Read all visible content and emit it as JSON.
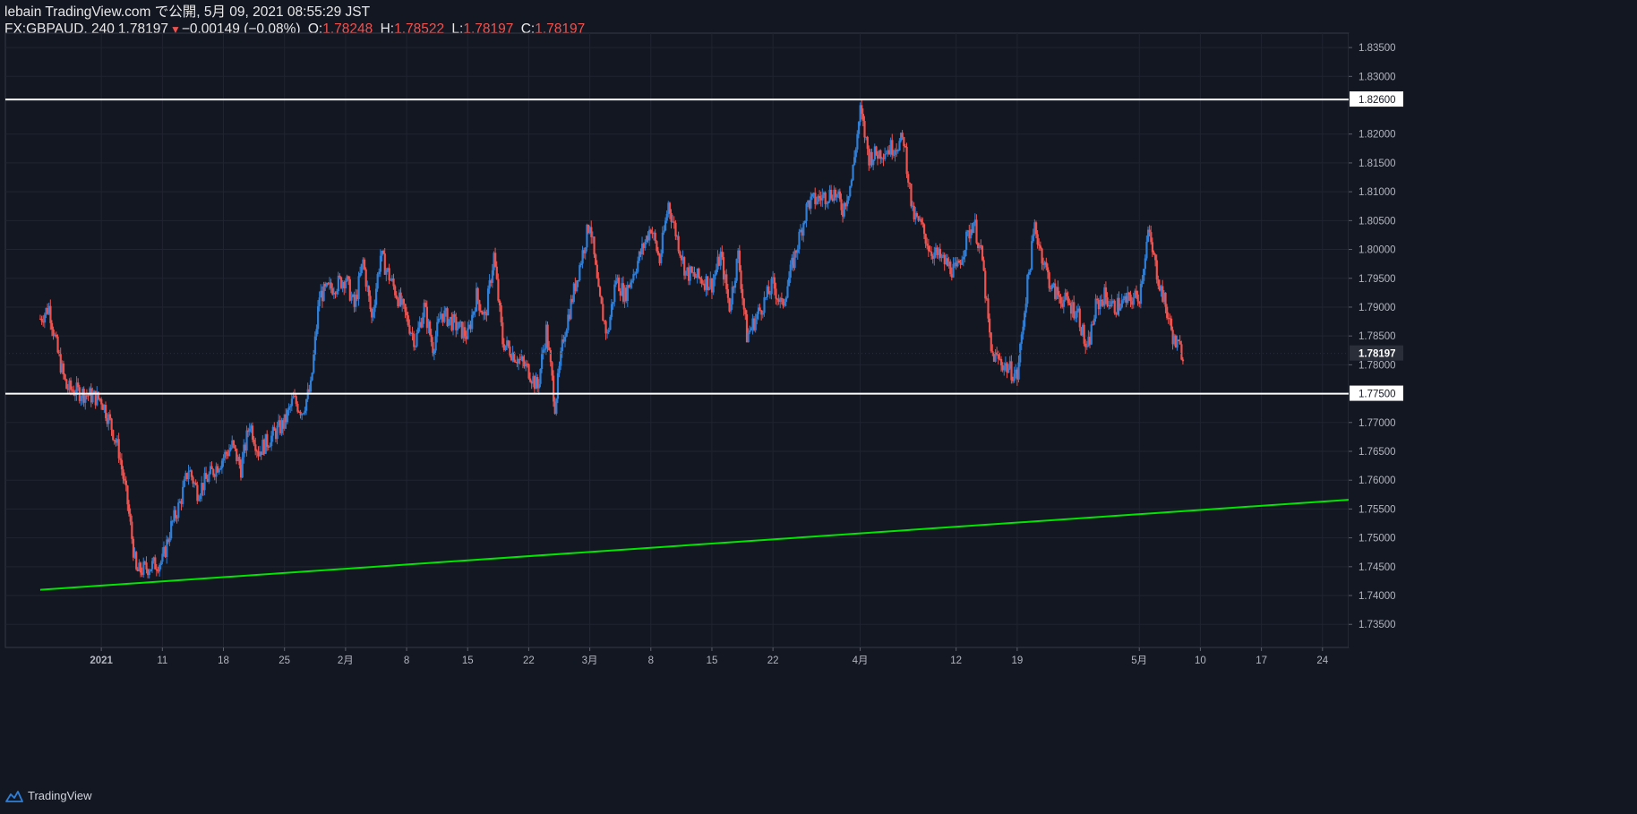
{
  "header": {
    "published": "lebain TradingView.com で公開, 5月 09, 2021 08:55:29 JST",
    "symbol": "FX:GBPAUD, 240",
    "last": "1.78197",
    "change": "−0.00149 (−0.08%)",
    "o_label": "O:",
    "o_value": "1.78248",
    "h_label": "H:",
    "h_value": "1.78522",
    "l_label": "L:",
    "l_value": "1.78197",
    "c_label": "C:",
    "c_value": "1.78197"
  },
  "footer": {
    "brand": "TradingView"
  },
  "colors": {
    "up": "#2f7fd8",
    "down": "#ef5350",
    "background": "#131722",
    "grid": "#1f2430",
    "trendline": "#00e600",
    "level": "#ffffff",
    "axis_text": "#b2b5be"
  },
  "chart_data": {
    "type": "candlestick",
    "symbol": "FX:GBPAUD",
    "interval": "240",
    "ylim": [
      1.731,
      1.8375
    ],
    "y_ticks": [
      "1.83500",
      "1.83000",
      "1.82600",
      "1.82000",
      "1.81500",
      "1.81000",
      "1.80500",
      "1.80000",
      "1.79500",
      "1.79000",
      "1.78500",
      "1.78197",
      "1.78000",
      "1.77500",
      "1.77000",
      "1.76500",
      "1.76000",
      "1.75500",
      "1.75000",
      "1.74500",
      "1.74000",
      "1.73500"
    ],
    "y_tick_values": [
      1.835,
      1.83,
      1.826,
      1.82,
      1.815,
      1.81,
      1.805,
      1.8,
      1.795,
      1.79,
      1.785,
      1.78197,
      1.78,
      1.775,
      1.77,
      1.765,
      1.76,
      1.755,
      1.75,
      1.745,
      1.74,
      1.735
    ],
    "x_ticks": [
      "2021",
      "11",
      "18",
      "25",
      "2月",
      "8",
      "15",
      "22",
      "3月",
      "8",
      "15",
      "22",
      "4月",
      "12",
      "19",
      "5月",
      "10",
      "17",
      "24"
    ],
    "x_tick_dates": [
      "2021-01-04",
      "2021-01-11",
      "2021-01-18",
      "2021-01-25",
      "2021-02-01",
      "2021-02-08",
      "2021-02-15",
      "2021-02-22",
      "2021-03-01",
      "2021-03-08",
      "2021-03-15",
      "2021-03-22",
      "2021-04-01",
      "2021-04-12",
      "2021-04-19",
      "2021-05-03",
      "2021-05-10",
      "2021-05-17",
      "2021-05-24"
    ],
    "price_path": [
      [
        "2020-12-28",
        1.788
      ],
      [
        "2020-12-29",
        1.79
      ],
      [
        "2020-12-30",
        1.782
      ],
      [
        "2020-12-31",
        1.776
      ],
      [
        "2021-01-04",
        1.774
      ],
      [
        "2021-01-05",
        1.77
      ],
      [
        "2021-01-06",
        1.765
      ],
      [
        "2021-01-07",
        1.756
      ],
      [
        "2021-01-08",
        1.744
      ],
      [
        "2021-01-11",
        1.746
      ],
      [
        "2021-01-12",
        1.752
      ],
      [
        "2021-01-13",
        1.756
      ],
      [
        "2021-01-14",
        1.762
      ],
      [
        "2021-01-15",
        1.758
      ],
      [
        "2021-01-18",
        1.764
      ],
      [
        "2021-01-19",
        1.766
      ],
      [
        "2021-01-20",
        1.762
      ],
      [
        "2021-01-21",
        1.77
      ],
      [
        "2021-01-22",
        1.765
      ],
      [
        "2021-01-25",
        1.77
      ],
      [
        "2021-01-26",
        1.774
      ],
      [
        "2021-01-27",
        1.772
      ],
      [
        "2021-01-28",
        1.776
      ],
      [
        "2021-01-29",
        1.792
      ],
      [
        "2021-02-01",
        1.795
      ],
      [
        "2021-02-02",
        1.79
      ],
      [
        "2021-02-03",
        1.798
      ],
      [
        "2021-02-04",
        1.788
      ],
      [
        "2021-02-05",
        1.799
      ],
      [
        "2021-02-08",
        1.788
      ],
      [
        "2021-02-09",
        1.784
      ],
      [
        "2021-02-10",
        1.79
      ],
      [
        "2021-02-11",
        1.783
      ],
      [
        "2021-02-12",
        1.789
      ],
      [
        "2021-02-15",
        1.785
      ],
      [
        "2021-02-16",
        1.792
      ],
      [
        "2021-02-17",
        1.788
      ],
      [
        "2021-02-18",
        1.799
      ],
      [
        "2021-02-19",
        1.784
      ],
      [
        "2021-02-22",
        1.779
      ],
      [
        "2021-02-23",
        1.776
      ],
      [
        "2021-02-24",
        1.786
      ],
      [
        "2021-02-25",
        1.773
      ],
      [
        "2021-02-26",
        1.785
      ],
      [
        "2021-03-01",
        1.805
      ],
      [
        "2021-03-02",
        1.792
      ],
      [
        "2021-03-03",
        1.785
      ],
      [
        "2021-03-04",
        1.795
      ],
      [
        "2021-03-05",
        1.792
      ],
      [
        "2021-03-08",
        1.804
      ],
      [
        "2021-03-09",
        1.798
      ],
      [
        "2021-03-10",
        1.808
      ],
      [
        "2021-03-11",
        1.802
      ],
      [
        "2021-03-12",
        1.796
      ],
      [
        "2021-03-15",
        1.794
      ],
      [
        "2021-03-16",
        1.799
      ],
      [
        "2021-03-17",
        1.79
      ],
      [
        "2021-03-18",
        1.799
      ],
      [
        "2021-03-19",
        1.785
      ],
      [
        "2021-03-22",
        1.794
      ],
      [
        "2021-03-23",
        1.79
      ],
      [
        "2021-03-24",
        1.796
      ],
      [
        "2021-03-25",
        1.802
      ],
      [
        "2021-03-26",
        1.808
      ],
      [
        "2021-03-29",
        1.81
      ],
      [
        "2021-03-30",
        1.807
      ],
      [
        "2021-03-31",
        1.812
      ],
      [
        "2021-04-01",
        1.824
      ],
      [
        "2021-04-02",
        1.816
      ],
      [
        "2021-04-05",
        1.818
      ],
      [
        "2021-04-06",
        1.819
      ],
      [
        "2021-04-07",
        1.806
      ],
      [
        "2021-04-08",
        1.804
      ],
      [
        "2021-04-09",
        1.8
      ],
      [
        "2021-04-12",
        1.796
      ],
      [
        "2021-04-13",
        1.801
      ],
      [
        "2021-04-14",
        1.805
      ],
      [
        "2021-04-15",
        1.798
      ],
      [
        "2021-04-16",
        1.782
      ],
      [
        "2021-04-19",
        1.778
      ],
      [
        "2021-04-20",
        1.792
      ],
      [
        "2021-04-21",
        1.804
      ],
      [
        "2021-04-22",
        1.798
      ],
      [
        "2021-04-23",
        1.793
      ],
      [
        "2021-04-26",
        1.789
      ],
      [
        "2021-04-27",
        1.782
      ],
      [
        "2021-04-28",
        1.79
      ],
      [
        "2021-04-29",
        1.792
      ],
      [
        "2021-04-30",
        1.79
      ],
      [
        "2021-05-03",
        1.792
      ],
      [
        "2021-05-04",
        1.803
      ],
      [
        "2021-05-05",
        1.796
      ],
      [
        "2021-05-06",
        1.79
      ],
      [
        "2021-05-07",
        1.784
      ],
      [
        "2021-05-08",
        1.782
      ]
    ],
    "candles_per_day": 6,
    "drawings": [
      {
        "type": "horizontal_line",
        "price": 1.826,
        "label": "1.82600",
        "color": "#ffffff"
      },
      {
        "type": "horizontal_line",
        "price": 1.775,
        "label": "1.77500",
        "color": "#ffffff"
      },
      {
        "type": "trendline",
        "points": [
          [
            "2020-12-28",
            1.741
          ],
          [
            "2021-05-27",
            1.7566
          ]
        ],
        "color": "#00e600"
      }
    ],
    "last_price": 1.78197,
    "last_price_label": "1.78197"
  }
}
